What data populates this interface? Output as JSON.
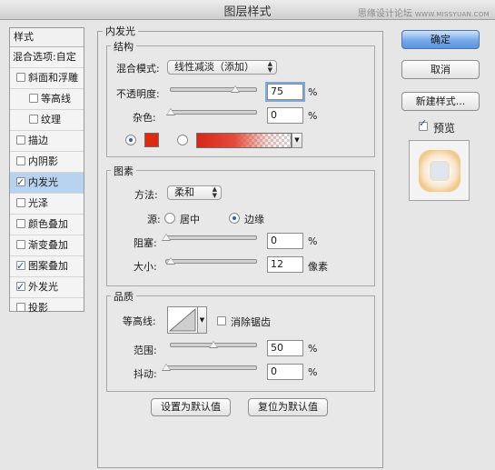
{
  "window": {
    "title": "图层样式"
  },
  "watermark": {
    "text": "思缘设计论坛",
    "url": "WWW.MISSYUAN.COM"
  },
  "sidebar": {
    "header": "样式",
    "blend_options": "混合选项:自定",
    "items": [
      {
        "label": "斜面和浮雕",
        "checked": false
      },
      {
        "label": "等高线",
        "checked": false
      },
      {
        "label": "纹理",
        "checked": false
      },
      {
        "label": "描边",
        "checked": false
      },
      {
        "label": "内阴影",
        "checked": false
      },
      {
        "label": "内发光",
        "checked": true
      },
      {
        "label": "光泽",
        "checked": false
      },
      {
        "label": "颜色叠加",
        "checked": false
      },
      {
        "label": "渐变叠加",
        "checked": false
      },
      {
        "label": "图案叠加",
        "checked": true
      },
      {
        "label": "外发光",
        "checked": true
      },
      {
        "label": "投影",
        "checked": false
      }
    ]
  },
  "panel": {
    "title": "内发光",
    "structure": {
      "title": "结构",
      "blend_mode_label": "混合模式:",
      "blend_mode_value": "线性减淡（添加）",
      "opacity_label": "不透明度:",
      "opacity_value": "75",
      "opacity_fraction": 0.75,
      "noise_label": "杂色:",
      "noise_value": "0",
      "noise_fraction": 0,
      "percent": "%",
      "color": "#dd2a10"
    },
    "elements": {
      "title": "图素",
      "technique_label": "方法:",
      "technique_value": "柔和",
      "source_label": "源:",
      "source_center": "居中",
      "source_edge": "边缘",
      "source_selected": "edge",
      "choke_label": "阻塞:",
      "choke_value": "0",
      "choke_fraction": 0,
      "size_label": "大小:",
      "size_value": "12",
      "size_fraction": 0.05,
      "percent": "%",
      "size_unit": "像素"
    },
    "quality": {
      "title": "品质",
      "contour_label": "等高线:",
      "antialias_label": "消除锯齿",
      "antialias_checked": false,
      "range_label": "范围:",
      "range_value": "50",
      "range_fraction": 0.5,
      "jitter_label": "抖动:",
      "jitter_value": "0",
      "jitter_fraction": 0,
      "percent": "%"
    },
    "make_default": "设置为默认值",
    "reset_default": "复位为默认值"
  },
  "buttons": {
    "ok": "确定",
    "cancel": "取消",
    "new_style": "新建样式...",
    "preview_label": "预览",
    "preview_checked": true
  }
}
